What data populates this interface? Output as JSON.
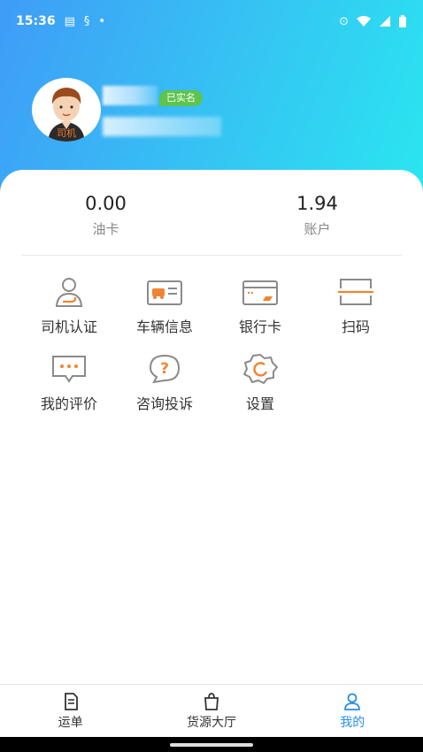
{
  "status_bar": {
    "time": "15:36"
  },
  "profile": {
    "avatar_tag": "司机",
    "verified_badge": "已实名"
  },
  "balances": [
    {
      "value": "0.00",
      "label": "油卡"
    },
    {
      "value": "1.94",
      "label": "账户"
    }
  ],
  "menu": {
    "row1": [
      {
        "label": "司机认证",
        "icon": "driver-id-icon"
      },
      {
        "label": "车辆信息",
        "icon": "vehicle-card-icon"
      },
      {
        "label": "银行卡",
        "icon": "bank-card-icon"
      },
      {
        "label": "扫码",
        "icon": "scan-icon"
      }
    ],
    "row2": [
      {
        "label": "我的评价",
        "icon": "chat-bubble-icon"
      },
      {
        "label": "咨询投诉",
        "icon": "question-bubble-icon"
      },
      {
        "label": "设置",
        "icon": "gear-icon"
      }
    ]
  },
  "tabbar": {
    "tabs": [
      {
        "label": "运单",
        "icon": "document-icon",
        "active": false
      },
      {
        "label": "货源大厅",
        "icon": "bag-icon",
        "active": false
      },
      {
        "label": "我的",
        "icon": "person-icon",
        "active": true
      }
    ]
  },
  "colors": {
    "header_gradient_start": "#3f9cf7",
    "header_gradient_end": "#2ae6f0",
    "icon_gray": "#8a8a8a",
    "icon_orange": "#ef8433",
    "active_tab": "#2a8fe6",
    "badge_green": "#5ec44d"
  }
}
